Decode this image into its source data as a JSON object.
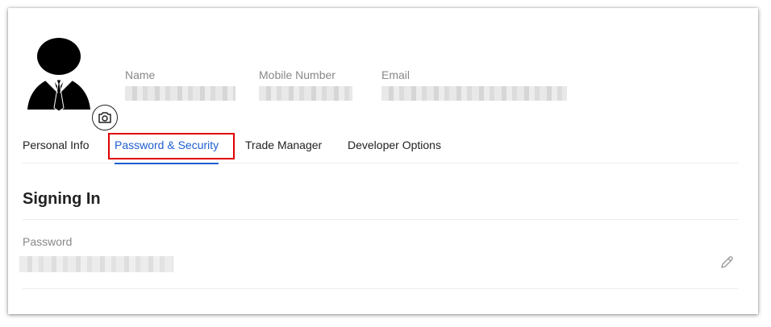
{
  "profile": {
    "fields": [
      {
        "label": "Name",
        "value": ""
      },
      {
        "label": "Mobile Number",
        "value": ""
      },
      {
        "label": "Email",
        "value": ""
      }
    ],
    "avatar_icon": "businessman-avatar-icon",
    "camera_icon": "camera-icon"
  },
  "tabs": [
    {
      "label": "Personal Info",
      "active": false
    },
    {
      "label": "Password & Security",
      "active": true
    },
    {
      "label": "Trade Manager",
      "active": false
    },
    {
      "label": "Developer Options",
      "active": false
    }
  ],
  "section": {
    "title": "Signing In",
    "password_label": "Password",
    "password_value": "",
    "edit_icon": "pencil-icon"
  },
  "colors": {
    "accent": "#1f5fd1",
    "highlight": "#e00000",
    "label": "#888888"
  }
}
